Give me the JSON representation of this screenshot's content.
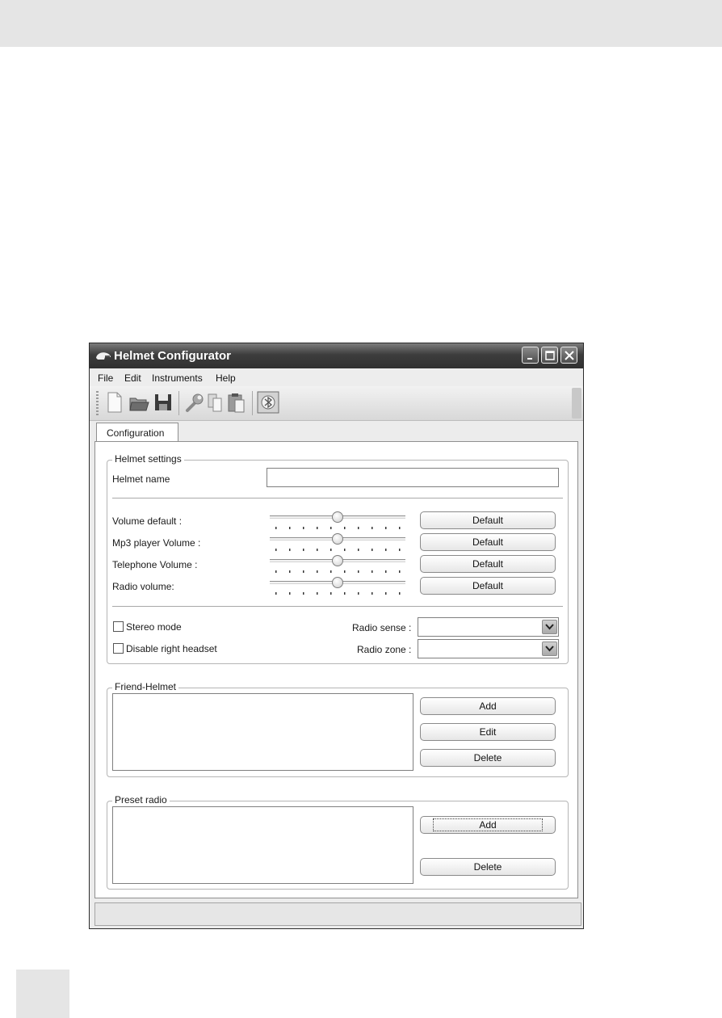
{
  "window": {
    "title": "Helmet Configurator"
  },
  "menu": {
    "file": "File",
    "edit": "Edit",
    "instruments": "Instruments",
    "help": "Help"
  },
  "toolbar": {
    "icons": [
      "new-file-icon",
      "open-folder-icon",
      "save-icon",
      "wrench-icon",
      "copy-icon",
      "paste-icon",
      "bluetooth-icon"
    ]
  },
  "tabs": {
    "configuration": "Configuration"
  },
  "helmet_settings": {
    "legend": "Helmet settings",
    "name_label": "Helmet name",
    "name_value": "",
    "volumes": [
      {
        "label": "Volume default :",
        "level": 0.5,
        "button": "Default"
      },
      {
        "label": "Mp3 player Volume :",
        "level": 0.5,
        "button": "Default"
      },
      {
        "label": "Telephone Volume :",
        "level": 0.5,
        "button": "Default"
      },
      {
        "label": "Radio volume:",
        "level": 0.5,
        "button": "Default"
      }
    ],
    "stereo_mode": {
      "label": "Stereo mode",
      "checked": false
    },
    "disable_right_headset": {
      "label": "Disable right headset",
      "checked": false
    },
    "radio_sense": {
      "label": "Radio sense :",
      "value": ""
    },
    "radio_zone": {
      "label": "Radio zone :",
      "value": ""
    }
  },
  "friend_helmet": {
    "legend": "Friend-Helmet",
    "add": "Add",
    "edit": "Edit",
    "delete": "Delete"
  },
  "preset_radio": {
    "legend": "Preset radio",
    "add": "Add",
    "delete": "Delete"
  },
  "colors": {
    "titlebar": "#3d3d3d",
    "window_bg": "#ececec",
    "band": "#e5e5e5"
  }
}
